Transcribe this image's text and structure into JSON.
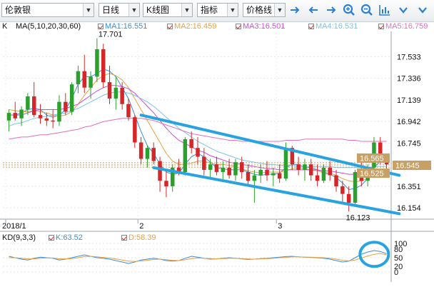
{
  "toolbar": {
    "instrument": "伦敦银",
    "period": "日线",
    "chart_type": "K线图",
    "indicator": "指标",
    "price_line": "价格线"
  },
  "legend": {
    "main_label": "K",
    "ma_params": "MA(5,10,20,30,60)",
    "ma1": "MA1:16.551",
    "ma2": "MA2:16.459",
    "ma3": "MA3:16.501",
    "ma4": "MA4:16.531",
    "ma5": "MA5:16.759",
    "colors": {
      "ma1": "#3a8fd9",
      "ma2": "#e8a040",
      "ma3": "#d04bd8",
      "ma4": "#7bc4e8",
      "ma5": "#e070c0"
    }
  },
  "price_axis": {
    "ticks": [
      "17.533",
      "17.336",
      "17.139",
      "16.942",
      "16.745",
      "16.351",
      "16.154"
    ],
    "tags": [
      {
        "label": "16.565",
        "color": "#c9a063"
      },
      {
        "label": "16.545",
        "color": "#c9a063"
      },
      {
        "label": "16.525",
        "color": "#c9a063"
      }
    ]
  },
  "annotations": {
    "high": "17.701",
    "low": "16.123"
  },
  "time_axis": {
    "labels": [
      "2018/1",
      "2",
      "3"
    ]
  },
  "kd": {
    "label": "KD(9,3,3)",
    "k": "K:63.52",
    "d": "D:58.39",
    "ticks": [
      "100",
      "80",
      "50",
      "20",
      "0"
    ],
    "colors": {
      "k": "#3a8fd9",
      "d": "#e8a040"
    }
  },
  "colors": {
    "up": "#2ca02c",
    "down": "#d62728",
    "channel": "#29a3e0"
  },
  "chart_data": {
    "type": "candlestick",
    "ylim": [
      16.05,
      17.75
    ],
    "candles": [
      {
        "o": 16.95,
        "h": 17.05,
        "l": 16.85,
        "c": 17.02
      },
      {
        "o": 17.02,
        "h": 17.12,
        "l": 16.95,
        "c": 16.97
      },
      {
        "o": 16.97,
        "h": 17.08,
        "l": 16.9,
        "c": 17.05
      },
      {
        "o": 17.05,
        "h": 17.2,
        "l": 17.0,
        "c": 17.17
      },
      {
        "o": 17.17,
        "h": 17.3,
        "l": 16.98,
        "c": 17.0
      },
      {
        "o": 17.0,
        "h": 17.1,
        "l": 16.92,
        "c": 16.97
      },
      {
        "o": 16.97,
        "h": 17.02,
        "l": 16.9,
        "c": 16.95
      },
      {
        "o": 16.95,
        "h": 17.05,
        "l": 16.88,
        "c": 16.94
      },
      {
        "o": 16.94,
        "h": 17.18,
        "l": 16.9,
        "c": 17.12
      },
      {
        "o": 17.12,
        "h": 17.2,
        "l": 17.0,
        "c": 17.03
      },
      {
        "o": 17.03,
        "h": 17.3,
        "l": 17.0,
        "c": 17.28
      },
      {
        "o": 17.28,
        "h": 17.45,
        "l": 17.2,
        "c": 17.4
      },
      {
        "o": 17.4,
        "h": 17.55,
        "l": 17.2,
        "c": 17.25
      },
      {
        "o": 17.25,
        "h": 17.4,
        "l": 17.15,
        "c": 17.35
      },
      {
        "o": 17.35,
        "h": 17.7,
        "l": 17.3,
        "c": 17.6
      },
      {
        "o": 17.6,
        "h": 17.65,
        "l": 17.25,
        "c": 17.3
      },
      {
        "o": 17.3,
        "h": 17.45,
        "l": 17.1,
        "c": 17.15
      },
      {
        "o": 17.15,
        "h": 17.35,
        "l": 17.05,
        "c": 17.25
      },
      {
        "o": 17.25,
        "h": 17.3,
        "l": 17.05,
        "c": 17.1
      },
      {
        "o": 17.1,
        "h": 17.15,
        "l": 16.95,
        "c": 16.98
      },
      {
        "o": 16.98,
        "h": 17.0,
        "l": 16.7,
        "c": 16.75
      },
      {
        "o": 16.75,
        "h": 16.8,
        "l": 16.55,
        "c": 16.6
      },
      {
        "o": 16.6,
        "h": 16.72,
        "l": 16.52,
        "c": 16.7
      },
      {
        "o": 16.7,
        "h": 16.75,
        "l": 16.55,
        "c": 16.58
      },
      {
        "o": 16.58,
        "h": 16.62,
        "l": 16.3,
        "c": 16.4
      },
      {
        "o": 16.4,
        "h": 16.5,
        "l": 16.25,
        "c": 16.35
      },
      {
        "o": 16.35,
        "h": 16.55,
        "l": 16.3,
        "c": 16.52
      },
      {
        "o": 16.52,
        "h": 16.6,
        "l": 16.45,
        "c": 16.48
      },
      {
        "o": 16.48,
        "h": 16.8,
        "l": 16.45,
        "c": 16.78
      },
      {
        "o": 16.78,
        "h": 16.85,
        "l": 16.65,
        "c": 16.7
      },
      {
        "o": 16.7,
        "h": 16.8,
        "l": 16.55,
        "c": 16.62
      },
      {
        "o": 16.62,
        "h": 16.7,
        "l": 16.45,
        "c": 16.5
      },
      {
        "o": 16.5,
        "h": 16.6,
        "l": 16.42,
        "c": 16.55
      },
      {
        "o": 16.55,
        "h": 16.62,
        "l": 16.45,
        "c": 16.48
      },
      {
        "o": 16.48,
        "h": 16.58,
        "l": 16.4,
        "c": 16.52
      },
      {
        "o": 16.52,
        "h": 16.6,
        "l": 16.42,
        "c": 16.45
      },
      {
        "o": 16.45,
        "h": 16.6,
        "l": 16.4,
        "c": 16.57
      },
      {
        "o": 16.57,
        "h": 16.62,
        "l": 16.42,
        "c": 16.48
      },
      {
        "o": 16.48,
        "h": 16.55,
        "l": 16.35,
        "c": 16.4
      },
      {
        "o": 16.4,
        "h": 16.5,
        "l": 16.2,
        "c": 16.45
      },
      {
        "o": 16.45,
        "h": 16.55,
        "l": 16.38,
        "c": 16.5
      },
      {
        "o": 16.5,
        "h": 16.58,
        "l": 16.4,
        "c": 16.45
      },
      {
        "o": 16.45,
        "h": 16.52,
        "l": 16.35,
        "c": 16.47
      },
      {
        "o": 16.47,
        "h": 16.55,
        "l": 16.38,
        "c": 16.42
      },
      {
        "o": 16.42,
        "h": 16.75,
        "l": 16.4,
        "c": 16.7
      },
      {
        "o": 16.7,
        "h": 16.72,
        "l": 16.5,
        "c": 16.55
      },
      {
        "o": 16.55,
        "h": 16.62,
        "l": 16.45,
        "c": 16.5
      },
      {
        "o": 16.5,
        "h": 16.6,
        "l": 16.4,
        "c": 16.55
      },
      {
        "o": 16.55,
        "h": 16.6,
        "l": 16.4,
        "c": 16.45
      },
      {
        "o": 16.45,
        "h": 16.55,
        "l": 16.35,
        "c": 16.4
      },
      {
        "o": 16.4,
        "h": 16.55,
        "l": 16.38,
        "c": 16.52
      },
      {
        "o": 16.52,
        "h": 16.58,
        "l": 16.4,
        "c": 16.45
      },
      {
        "o": 16.45,
        "h": 16.5,
        "l": 16.3,
        "c": 16.35
      },
      {
        "o": 16.35,
        "h": 16.4,
        "l": 16.2,
        "c": 16.28
      },
      {
        "o": 16.28,
        "h": 16.35,
        "l": 16.12,
        "c": 16.2
      },
      {
        "o": 16.2,
        "h": 16.5,
        "l": 16.18,
        "c": 16.48
      },
      {
        "o": 16.48,
        "h": 16.65,
        "l": 16.35,
        "c": 16.4
      },
      {
        "o": 16.4,
        "h": 16.55,
        "l": 16.35,
        "c": 16.52
      },
      {
        "o": 16.52,
        "h": 16.8,
        "l": 16.5,
        "c": 16.75
      },
      {
        "o": 16.75,
        "h": 16.8,
        "l": 16.55,
        "c": 16.6
      },
      {
        "o": 16.6,
        "h": 16.62,
        "l": 16.5,
        "c": 16.55
      }
    ],
    "channel_lines": [
      {
        "from": [
          21,
          17.0
        ],
        "to": [
          62,
          16.45
        ]
      },
      {
        "from": [
          23,
          16.52
        ],
        "to": [
          62,
          16.1
        ]
      }
    ],
    "ma_series": {
      "ma1": [
        17.0,
        17.0,
        17.02,
        17.05,
        17.06,
        17.05,
        17.0,
        16.98,
        17.0,
        17.05,
        17.15,
        17.28,
        17.35,
        17.35,
        17.38,
        17.42,
        17.4,
        17.35,
        17.25,
        17.15,
        17.0,
        16.85,
        16.72,
        16.65,
        16.55,
        16.48,
        16.46,
        16.47,
        16.55,
        16.62,
        16.65,
        16.62,
        16.57,
        16.52,
        16.51,
        16.5,
        16.5,
        16.5,
        16.48,
        16.46,
        16.45,
        16.46,
        16.46,
        16.47,
        16.52,
        16.55,
        16.55,
        16.52,
        16.52,
        16.5,
        16.47,
        16.46,
        16.43,
        16.38,
        16.32,
        16.33,
        16.36,
        16.42,
        16.52,
        16.58,
        16.57
      ],
      "ma2": [
        17.05,
        17.04,
        17.03,
        17.03,
        17.04,
        17.03,
        17.02,
        17.0,
        16.99,
        17.0,
        17.03,
        17.1,
        17.18,
        17.25,
        17.32,
        17.36,
        17.38,
        17.36,
        17.32,
        17.25,
        17.15,
        17.05,
        16.95,
        16.85,
        16.75,
        16.65,
        16.58,
        16.55,
        16.55,
        16.56,
        16.58,
        16.58,
        16.56,
        16.55,
        16.55,
        16.54,
        16.53,
        16.51,
        16.49,
        16.48,
        16.47,
        16.48,
        16.48,
        16.48,
        16.49,
        16.51,
        16.52,
        16.51,
        16.5,
        16.49,
        16.48,
        16.47,
        16.45,
        16.42,
        16.4,
        16.39,
        16.4,
        16.42,
        16.45,
        16.46,
        16.46
      ],
      "ma3": [
        17.0,
        17.0,
        17.0,
        17.02,
        17.04,
        17.05,
        17.05,
        17.05,
        17.05,
        17.06,
        17.08,
        17.1,
        17.14,
        17.18,
        17.22,
        17.25,
        17.27,
        17.27,
        17.26,
        17.24,
        17.2,
        17.14,
        17.08,
        17.02,
        16.95,
        16.88,
        16.82,
        16.77,
        16.74,
        16.71,
        16.68,
        16.66,
        16.63,
        16.61,
        16.59,
        16.57,
        16.56,
        16.55,
        16.54,
        16.53,
        16.52,
        16.51,
        16.51,
        16.5,
        16.5,
        16.5,
        16.5,
        16.5,
        16.5,
        16.5,
        16.49,
        16.49,
        16.48,
        16.47,
        16.46,
        16.46,
        16.46,
        16.47,
        16.49,
        16.5,
        16.5
      ],
      "ma4": [
        16.9,
        16.92,
        16.93,
        16.95,
        16.97,
        16.98,
        16.99,
        17.0,
        17.01,
        17.02,
        17.04,
        17.06,
        17.09,
        17.12,
        17.15,
        17.18,
        17.2,
        17.21,
        17.21,
        17.2,
        17.18,
        17.15,
        17.12,
        17.08,
        17.03,
        16.98,
        16.93,
        16.88,
        16.84,
        16.8,
        16.76,
        16.73,
        16.7,
        16.67,
        16.65,
        16.63,
        16.61,
        16.59,
        16.58,
        16.57,
        16.56,
        16.55,
        16.55,
        16.54,
        16.54,
        16.54,
        16.53,
        16.53,
        16.53,
        16.53,
        16.53,
        16.53,
        16.52,
        16.52,
        16.52,
        16.52,
        16.52,
        16.52,
        16.53,
        16.53,
        16.53
      ],
      "ma5": [
        16.78,
        16.79,
        16.8,
        16.8,
        16.81,
        16.82,
        16.82,
        16.83,
        16.84,
        16.85,
        16.86,
        16.87,
        16.89,
        16.9,
        16.92,
        16.94,
        16.95,
        16.96,
        16.97,
        16.97,
        16.97,
        16.97,
        16.96,
        16.95,
        16.93,
        16.91,
        16.89,
        16.87,
        16.85,
        16.83,
        16.82,
        16.81,
        16.8,
        16.79,
        16.78,
        16.77,
        16.77,
        16.76,
        16.76,
        16.76,
        16.76,
        16.76,
        16.76,
        16.76,
        16.77,
        16.77,
        16.77,
        16.78,
        16.78,
        16.78,
        16.78,
        16.78,
        16.78,
        16.78,
        16.77,
        16.77,
        16.76,
        16.76,
        16.76,
        16.76,
        16.76
      ]
    },
    "kd_series": {
      "ylim": [
        0,
        100
      ],
      "k": [
        55,
        50,
        45,
        42,
        48,
        52,
        50,
        48,
        42,
        45,
        50,
        55,
        60,
        55,
        50,
        48,
        45,
        40,
        35,
        30,
        35,
        42,
        45,
        48,
        45,
        40,
        38,
        40,
        48,
        55,
        52,
        48,
        45,
        46,
        48,
        50,
        48,
        46,
        44,
        45,
        47,
        48,
        50,
        52,
        54,
        55,
        53,
        52,
        51,
        50,
        48,
        45,
        40,
        35,
        38,
        50,
        62,
        70,
        75,
        72,
        64
      ],
      "d": [
        50,
        50,
        48,
        46,
        46,
        48,
        49,
        49,
        46,
        46,
        47,
        50,
        54,
        55,
        53,
        51,
        49,
        46,
        42,
        38,
        37,
        39,
        41,
        44,
        45,
        43,
        41,
        40,
        43,
        47,
        49,
        48,
        47,
        46,
        47,
        48,
        48,
        47,
        46,
        45,
        46,
        47,
        48,
        50,
        51,
        53,
        53,
        52,
        52,
        51,
        50,
        48,
        45,
        41,
        39,
        42,
        49,
        56,
        62,
        65,
        60
      ]
    }
  }
}
